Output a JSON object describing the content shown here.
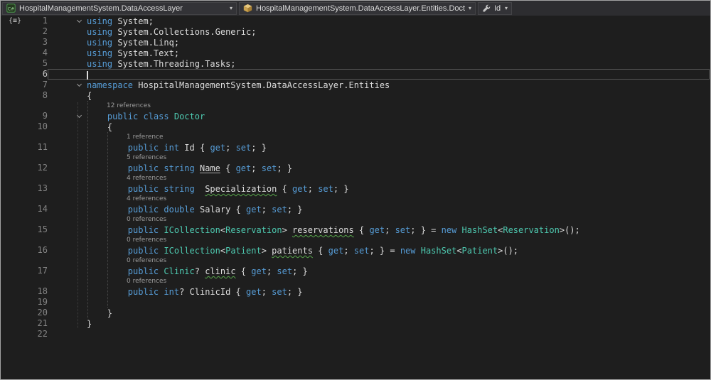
{
  "navbar": {
    "project": "HospitalManagementSystem.DataAccessLayer",
    "type": "HospitalManagementSystem.DataAccessLayer.Entities.Doctor",
    "member": "Id",
    "dropdown_arrow": "▾"
  },
  "colors": {
    "editor_background": "#1E1E1E",
    "navbar_background": "#2D2D30",
    "keyword": "#569CD6",
    "type_name": "#4EC9B0",
    "plain_text": "#DCDCDC",
    "line_number": "#858585",
    "codelens_text": "#9B9B9B",
    "squiggle": "#57A64A"
  },
  "editor": {
    "glyph_icon": "{≡}",
    "rows": [
      {
        "n": "1",
        "fold": true,
        "glyph": true,
        "t": [
          [
            "kw",
            "using"
          ],
          [
            "pl",
            " System;"
          ]
        ]
      },
      {
        "n": "2",
        "t": [
          [
            "kw",
            "using"
          ],
          [
            "pl",
            " System.Collections.Generic;"
          ]
        ]
      },
      {
        "n": "3",
        "t": [
          [
            "kw",
            "using"
          ],
          [
            "pl",
            " System.Linq;"
          ]
        ]
      },
      {
        "n": "4",
        "t": [
          [
            "kw",
            "using"
          ],
          [
            "pl",
            " System.Text;"
          ]
        ]
      },
      {
        "n": "5",
        "t": [
          [
            "kw",
            "using"
          ],
          [
            "pl",
            " System.Threading.Tasks;"
          ]
        ]
      },
      {
        "n": "6",
        "cursor": true,
        "t": []
      },
      {
        "n": "7",
        "fold": true,
        "t": [
          [
            "kw",
            "namespace"
          ],
          [
            "pl",
            " HospitalManagementSystem.DataAccessLayer.Entities"
          ]
        ]
      },
      {
        "n": "8",
        "t": [
          [
            "pl",
            "{"
          ]
        ]
      },
      {
        "lens": true,
        "indent": 28,
        "text": "12 references"
      },
      {
        "n": "9",
        "fold": true,
        "t": [
          [
            "pl",
            "    "
          ],
          [
            "kw",
            "public"
          ],
          [
            "pl",
            " "
          ],
          [
            "kw",
            "class"
          ],
          [
            "pl",
            " "
          ],
          [
            "ty",
            "Doctor"
          ]
        ]
      },
      {
        "n": "10",
        "t": [
          [
            "pl",
            "    {"
          ]
        ]
      },
      {
        "lens": true,
        "indent": 56,
        "text": "1 reference"
      },
      {
        "n": "11",
        "t": [
          [
            "pl",
            "        "
          ],
          [
            "kw",
            "public"
          ],
          [
            "pl",
            " "
          ],
          [
            "kw",
            "int"
          ],
          [
            "pl",
            " Id { "
          ],
          [
            "kw",
            "get"
          ],
          [
            "pl",
            "; "
          ],
          [
            "kw",
            "set"
          ],
          [
            "pl",
            "; }"
          ]
        ]
      },
      {
        "lens": true,
        "indent": 56,
        "text": "5 references"
      },
      {
        "n": "12",
        "t": [
          [
            "pl",
            "        "
          ],
          [
            "kw",
            "public"
          ],
          [
            "pl",
            " "
          ],
          [
            "kw",
            "string"
          ],
          [
            "pl",
            " "
          ],
          [
            "us",
            "Name"
          ],
          [
            "pl",
            " { "
          ],
          [
            "kw",
            "get"
          ],
          [
            "pl",
            "; "
          ],
          [
            "kw",
            "set"
          ],
          [
            "pl",
            "; }"
          ]
        ]
      },
      {
        "lens": true,
        "indent": 56,
        "text": "4 references"
      },
      {
        "n": "13",
        "t": [
          [
            "pl",
            "        "
          ],
          [
            "kw",
            "public"
          ],
          [
            "pl",
            " "
          ],
          [
            "kw",
            "string"
          ],
          [
            "pl",
            "  "
          ],
          [
            "ug",
            "Specialization"
          ],
          [
            "pl",
            " { "
          ],
          [
            "kw",
            "get"
          ],
          [
            "pl",
            "; "
          ],
          [
            "kw",
            "set"
          ],
          [
            "pl",
            "; }"
          ]
        ]
      },
      {
        "lens": true,
        "indent": 56,
        "text": "4 references"
      },
      {
        "n": "14",
        "t": [
          [
            "pl",
            "        "
          ],
          [
            "kw",
            "public"
          ],
          [
            "pl",
            " "
          ],
          [
            "kw",
            "double"
          ],
          [
            "pl",
            " Salary { "
          ],
          [
            "kw",
            "get"
          ],
          [
            "pl",
            "; "
          ],
          [
            "kw",
            "set"
          ],
          [
            "pl",
            "; }"
          ]
        ]
      },
      {
        "lens": true,
        "indent": 56,
        "text": "0 references"
      },
      {
        "n": "15",
        "t": [
          [
            "pl",
            "        "
          ],
          [
            "kw",
            "public"
          ],
          [
            "pl",
            " "
          ],
          [
            "ty",
            "ICollection"
          ],
          [
            "pl",
            "<"
          ],
          [
            "ty",
            "Reservation"
          ],
          [
            "pl",
            "> "
          ],
          [
            "ug",
            "reservations"
          ],
          [
            "pl",
            " { "
          ],
          [
            "kw",
            "get"
          ],
          [
            "pl",
            "; "
          ],
          [
            "kw",
            "set"
          ],
          [
            "pl",
            "; } = "
          ],
          [
            "kw",
            "new"
          ],
          [
            "pl",
            " "
          ],
          [
            "ty",
            "HashSet"
          ],
          [
            "pl",
            "<"
          ],
          [
            "ty",
            "Reservation"
          ],
          [
            "pl",
            ">();"
          ]
        ]
      },
      {
        "lens": true,
        "indent": 56,
        "text": "0 references"
      },
      {
        "n": "16",
        "t": [
          [
            "pl",
            "        "
          ],
          [
            "kw",
            "public"
          ],
          [
            "pl",
            " "
          ],
          [
            "ty",
            "ICollection"
          ],
          [
            "pl",
            "<"
          ],
          [
            "ty",
            "Patient"
          ],
          [
            "pl",
            "> "
          ],
          [
            "ug",
            "patients"
          ],
          [
            "pl",
            " { "
          ],
          [
            "kw",
            "get"
          ],
          [
            "pl",
            "; "
          ],
          [
            "kw",
            "set"
          ],
          [
            "pl",
            "; } = "
          ],
          [
            "kw",
            "new"
          ],
          [
            "pl",
            " "
          ],
          [
            "ty",
            "HashSet"
          ],
          [
            "pl",
            "<"
          ],
          [
            "ty",
            "Patient"
          ],
          [
            "pl",
            ">();"
          ]
        ]
      },
      {
        "lens": true,
        "indent": 56,
        "text": "0 references"
      },
      {
        "n": "17",
        "t": [
          [
            "pl",
            "        "
          ],
          [
            "kw",
            "public"
          ],
          [
            "pl",
            " "
          ],
          [
            "ty",
            "Clinic"
          ],
          [
            "pl",
            "? "
          ],
          [
            "ug",
            "clinic"
          ],
          [
            "pl",
            " { "
          ],
          [
            "kw",
            "get"
          ],
          [
            "pl",
            "; "
          ],
          [
            "kw",
            "set"
          ],
          [
            "pl",
            "; }"
          ]
        ]
      },
      {
        "lens": true,
        "indent": 56,
        "text": "0 references"
      },
      {
        "n": "18",
        "t": [
          [
            "pl",
            "        "
          ],
          [
            "kw",
            "public"
          ],
          [
            "pl",
            " "
          ],
          [
            "kw",
            "int"
          ],
          [
            "pl",
            "? ClinicId { "
          ],
          [
            "kw",
            "get"
          ],
          [
            "pl",
            "; "
          ],
          [
            "kw",
            "set"
          ],
          [
            "pl",
            "; }"
          ]
        ]
      },
      {
        "n": "19",
        "t": []
      },
      {
        "n": "20",
        "t": [
          [
            "pl",
            "    }"
          ]
        ]
      },
      {
        "n": "21",
        "t": [
          [
            "pl",
            "}"
          ]
        ]
      },
      {
        "n": "22",
        "t": []
      }
    ]
  }
}
